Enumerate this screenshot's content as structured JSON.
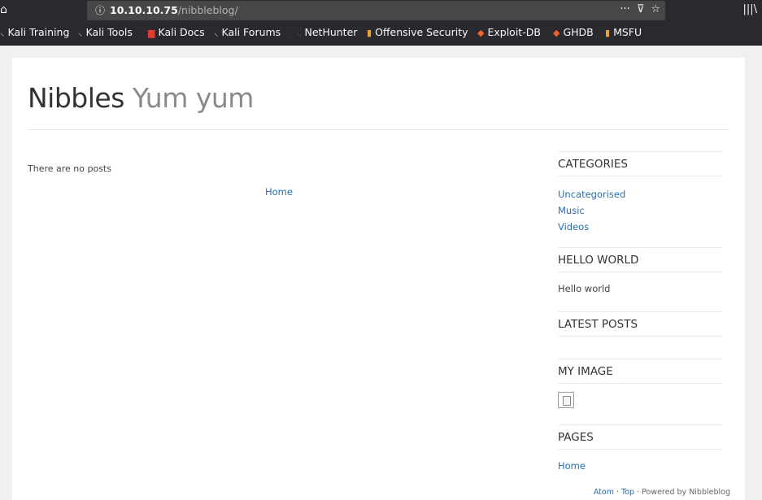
{
  "browser": {
    "url_host": "10.10.10.75",
    "url_path": "/nibbleblog/",
    "home_icon": "home-icon",
    "info_icon": "info-icon",
    "page_actions_icon": "meatball-menu-icon",
    "pocket_icon": "pocket-icon",
    "bookmark_star_icon": "star-icon",
    "library_icon": "library-icon",
    "bookmarks": [
      {
        "label": "Kali Training",
        "icon": "kali-dragon-icon"
      },
      {
        "label": "Kali Tools",
        "icon": "kali-dragon-icon"
      },
      {
        "label": "Kali Docs",
        "icon": "kali-docs-icon"
      },
      {
        "label": "Kali Forums",
        "icon": "kali-dragon-icon"
      },
      {
        "label": "NetHunter",
        "icon": "nethunter-icon"
      },
      {
        "label": "Offensive Security",
        "icon": "offsec-icon"
      },
      {
        "label": "Exploit-DB",
        "icon": "exploit-db-icon"
      },
      {
        "label": "GHDB",
        "icon": "exploit-db-icon"
      },
      {
        "label": "MSFU",
        "icon": "offsec-icon"
      }
    ]
  },
  "site": {
    "title": "Nibbles",
    "slogan": "Yum yum",
    "no_posts_text": "There are no posts",
    "home_link": "Home"
  },
  "sidebar": {
    "categories": {
      "title": "CATEGORIES",
      "items": [
        "Uncategorised",
        "Music",
        "Videos"
      ]
    },
    "hello_world": {
      "title": "HELLO WORLD",
      "text": "Hello world"
    },
    "latest_posts": {
      "title": "LATEST POSTS"
    },
    "my_image": {
      "title": "MY IMAGE",
      "image_icon": "broken-image-icon"
    },
    "pages": {
      "title": "PAGES",
      "items": [
        "Home"
      ]
    }
  },
  "footer": {
    "atom": "Atom",
    "sep1": " · ",
    "top": "Top",
    "sep2": " · ",
    "powered": "Powered by Nibbleblog"
  },
  "colors": {
    "chrome_bg": "#2a2a2e",
    "urlbar_bg": "#474749",
    "page_bg": "#f0f0f0",
    "link": "#2b6cb0"
  }
}
